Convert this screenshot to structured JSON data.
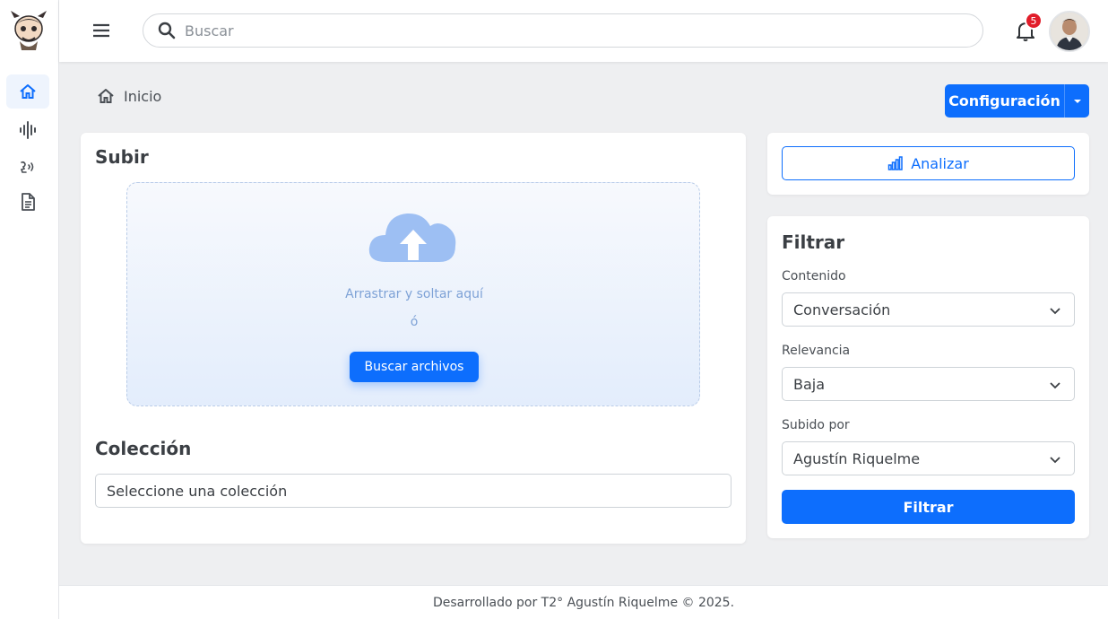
{
  "topbar": {
    "search_placeholder": "Buscar",
    "notifications_count": "5"
  },
  "sidebar": {
    "items": [
      {
        "icon": "home-icon",
        "active": true
      },
      {
        "icon": "audio-wave-icon",
        "active": false
      },
      {
        "icon": "voice-icon",
        "active": false
      },
      {
        "icon": "document-icon",
        "active": false
      }
    ]
  },
  "breadcrumb": {
    "label": "Inicio"
  },
  "config_button": {
    "label": "Configuración"
  },
  "upload": {
    "title": "Subir",
    "drop_text": "Arrastrar y soltar aquí",
    "or_text": "ó",
    "browse_label": "Buscar archivos"
  },
  "collection": {
    "title": "Colección",
    "placeholder": "Seleccione una colección"
  },
  "analyze": {
    "label": "Analizar"
  },
  "filter": {
    "title": "Filtrar",
    "fields": [
      {
        "label": "Contenido",
        "value": "Conversación"
      },
      {
        "label": "Relevancia",
        "value": "Baja"
      },
      {
        "label": "Subido por",
        "value": "Agustín Riquelme"
      }
    ],
    "button_label": "Filtrar"
  },
  "footer": {
    "text": "Desarrollado por T2° Agustín Riquelme © 2025."
  },
  "colors": {
    "primary": "#0d6efd",
    "badge": "#e11d2a",
    "background": "#eeeff1"
  }
}
